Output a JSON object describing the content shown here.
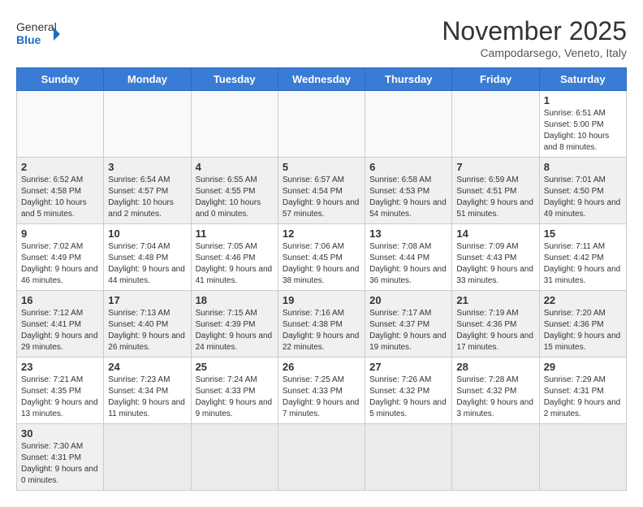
{
  "header": {
    "logo": {
      "general": "General",
      "blue": "Blue"
    },
    "title": "November 2025",
    "location": "Campodarsego, Veneto, Italy"
  },
  "weekdays": [
    "Sunday",
    "Monday",
    "Tuesday",
    "Wednesday",
    "Thursday",
    "Friday",
    "Saturday"
  ],
  "weeks": [
    [
      {
        "day": "",
        "info": ""
      },
      {
        "day": "",
        "info": ""
      },
      {
        "day": "",
        "info": ""
      },
      {
        "day": "",
        "info": ""
      },
      {
        "day": "",
        "info": ""
      },
      {
        "day": "",
        "info": ""
      },
      {
        "day": "1",
        "info": "Sunrise: 6:51 AM\nSunset: 5:00 PM\nDaylight: 10 hours and 8 minutes."
      }
    ],
    [
      {
        "day": "2",
        "info": "Sunrise: 6:52 AM\nSunset: 4:58 PM\nDaylight: 10 hours and 5 minutes."
      },
      {
        "day": "3",
        "info": "Sunrise: 6:54 AM\nSunset: 4:57 PM\nDaylight: 10 hours and 2 minutes."
      },
      {
        "day": "4",
        "info": "Sunrise: 6:55 AM\nSunset: 4:55 PM\nDaylight: 10 hours and 0 minutes."
      },
      {
        "day": "5",
        "info": "Sunrise: 6:57 AM\nSunset: 4:54 PM\nDaylight: 9 hours and 57 minutes."
      },
      {
        "day": "6",
        "info": "Sunrise: 6:58 AM\nSunset: 4:53 PM\nDaylight: 9 hours and 54 minutes."
      },
      {
        "day": "7",
        "info": "Sunrise: 6:59 AM\nSunset: 4:51 PM\nDaylight: 9 hours and 51 minutes."
      },
      {
        "day": "8",
        "info": "Sunrise: 7:01 AM\nSunset: 4:50 PM\nDaylight: 9 hours and 49 minutes."
      }
    ],
    [
      {
        "day": "9",
        "info": "Sunrise: 7:02 AM\nSunset: 4:49 PM\nDaylight: 9 hours and 46 minutes."
      },
      {
        "day": "10",
        "info": "Sunrise: 7:04 AM\nSunset: 4:48 PM\nDaylight: 9 hours and 44 minutes."
      },
      {
        "day": "11",
        "info": "Sunrise: 7:05 AM\nSunset: 4:46 PM\nDaylight: 9 hours and 41 minutes."
      },
      {
        "day": "12",
        "info": "Sunrise: 7:06 AM\nSunset: 4:45 PM\nDaylight: 9 hours and 38 minutes."
      },
      {
        "day": "13",
        "info": "Sunrise: 7:08 AM\nSunset: 4:44 PM\nDaylight: 9 hours and 36 minutes."
      },
      {
        "day": "14",
        "info": "Sunrise: 7:09 AM\nSunset: 4:43 PM\nDaylight: 9 hours and 33 minutes."
      },
      {
        "day": "15",
        "info": "Sunrise: 7:11 AM\nSunset: 4:42 PM\nDaylight: 9 hours and 31 minutes."
      }
    ],
    [
      {
        "day": "16",
        "info": "Sunrise: 7:12 AM\nSunset: 4:41 PM\nDaylight: 9 hours and 29 minutes."
      },
      {
        "day": "17",
        "info": "Sunrise: 7:13 AM\nSunset: 4:40 PM\nDaylight: 9 hours and 26 minutes."
      },
      {
        "day": "18",
        "info": "Sunrise: 7:15 AM\nSunset: 4:39 PM\nDaylight: 9 hours and 24 minutes."
      },
      {
        "day": "19",
        "info": "Sunrise: 7:16 AM\nSunset: 4:38 PM\nDaylight: 9 hours and 22 minutes."
      },
      {
        "day": "20",
        "info": "Sunrise: 7:17 AM\nSunset: 4:37 PM\nDaylight: 9 hours and 19 minutes."
      },
      {
        "day": "21",
        "info": "Sunrise: 7:19 AM\nSunset: 4:36 PM\nDaylight: 9 hours and 17 minutes."
      },
      {
        "day": "22",
        "info": "Sunrise: 7:20 AM\nSunset: 4:36 PM\nDaylight: 9 hours and 15 minutes."
      }
    ],
    [
      {
        "day": "23",
        "info": "Sunrise: 7:21 AM\nSunset: 4:35 PM\nDaylight: 9 hours and 13 minutes."
      },
      {
        "day": "24",
        "info": "Sunrise: 7:23 AM\nSunset: 4:34 PM\nDaylight: 9 hours and 11 minutes."
      },
      {
        "day": "25",
        "info": "Sunrise: 7:24 AM\nSunset: 4:33 PM\nDaylight: 9 hours and 9 minutes."
      },
      {
        "day": "26",
        "info": "Sunrise: 7:25 AM\nSunset: 4:33 PM\nDaylight: 9 hours and 7 minutes."
      },
      {
        "day": "27",
        "info": "Sunrise: 7:26 AM\nSunset: 4:32 PM\nDaylight: 9 hours and 5 minutes."
      },
      {
        "day": "28",
        "info": "Sunrise: 7:28 AM\nSunset: 4:32 PM\nDaylight: 9 hours and 3 minutes."
      },
      {
        "day": "29",
        "info": "Sunrise: 7:29 AM\nSunset: 4:31 PM\nDaylight: 9 hours and 2 minutes."
      }
    ],
    [
      {
        "day": "30",
        "info": "Sunrise: 7:30 AM\nSunset: 4:31 PM\nDaylight: 9 hours and 0 minutes."
      },
      {
        "day": "",
        "info": ""
      },
      {
        "day": "",
        "info": ""
      },
      {
        "day": "",
        "info": ""
      },
      {
        "day": "",
        "info": ""
      },
      {
        "day": "",
        "info": ""
      },
      {
        "day": "",
        "info": ""
      }
    ]
  ]
}
